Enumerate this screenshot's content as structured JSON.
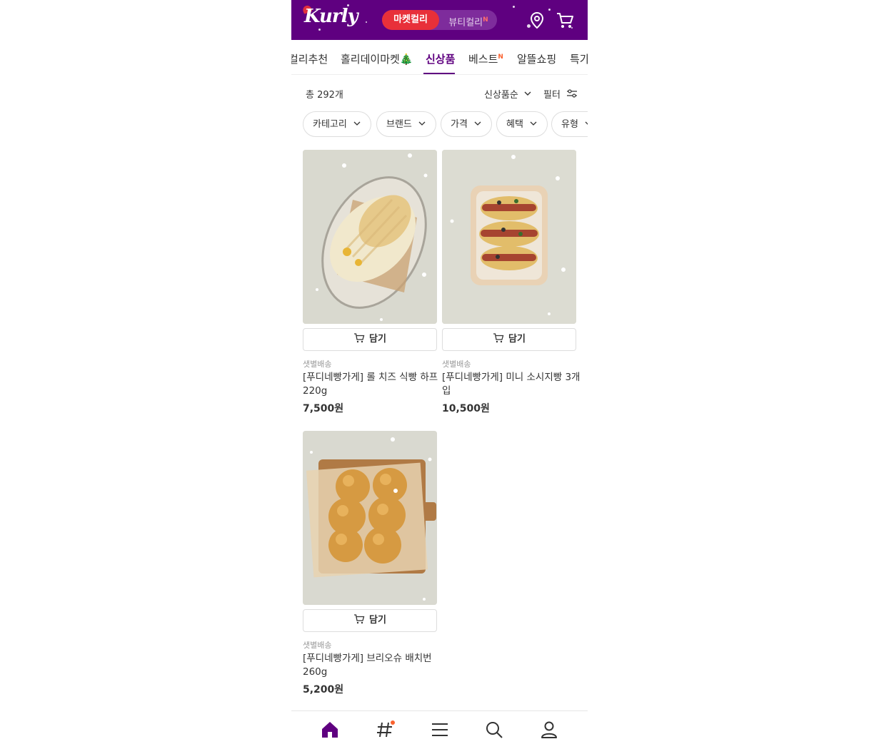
{
  "header": {
    "logo_text": "Kurly",
    "switch_active": "마켓컬리",
    "switch_inactive": "뷰티컬리",
    "switch_inactive_badge": "N",
    "brand_color": "#5f0080",
    "active_pill_color": "#e8303a",
    "icons": [
      "location-icon",
      "cart-icon"
    ]
  },
  "tabs": [
    {
      "label": "컬리추천"
    },
    {
      "label": "홀리데이마켓🎄"
    },
    {
      "label": "신상품",
      "active": true
    },
    {
      "label": "베스트",
      "badge": "N"
    },
    {
      "label": "알뜰쇼핑"
    },
    {
      "label": "특가"
    }
  ],
  "listing": {
    "count_label": "총 292개",
    "sort_label": "신상품순",
    "filter_label": "필터"
  },
  "chips": [
    "카테고리",
    "브랜드",
    "가격",
    "혜택",
    "유형"
  ],
  "cart_button_label": "담기",
  "products": [
    {
      "delivery": "샛별배송",
      "name": "[푸디네빵가게] 롤 치즈 식빵 하프 220g",
      "price": "7,500원",
      "image": "roll-cheese-bread"
    },
    {
      "delivery": "샛별배송",
      "name": "[푸디네빵가게] 미니 소시지빵 3개입",
      "price": "10,500원",
      "image": "mini-sausage-bread"
    },
    {
      "delivery": "샛별배송",
      "name": "[푸디네빵가게] 브리오슈 배치번 260g",
      "price": "5,200원",
      "image": "brioche-batch-bun"
    }
  ],
  "bottom_nav": [
    "home-icon",
    "hashtag-icon",
    "menu-icon",
    "search-icon",
    "user-icon"
  ]
}
